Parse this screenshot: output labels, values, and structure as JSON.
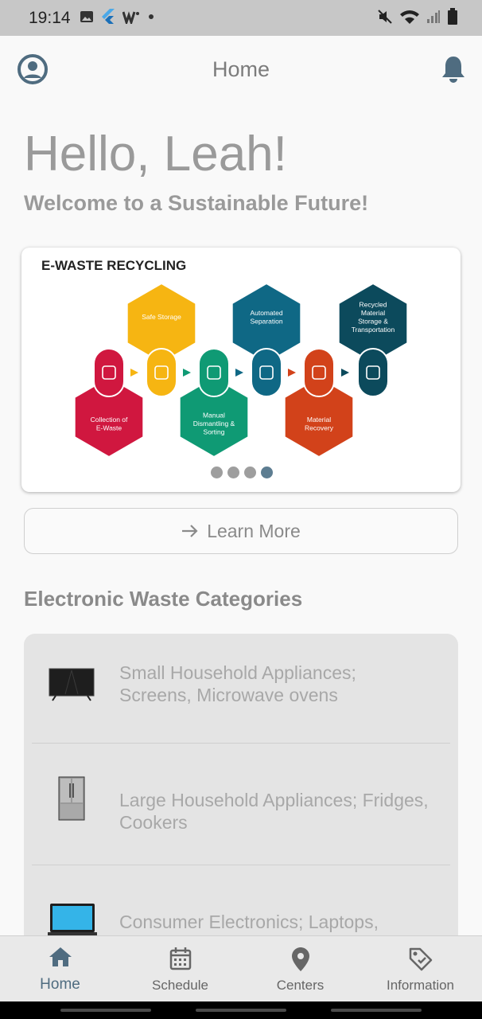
{
  "status_bar": {
    "time": "19:14"
  },
  "app_bar": {
    "title": "Home"
  },
  "greeting": "Hello, Leah!",
  "welcome": "Welcome to a Sustainable Future!",
  "carousel": {
    "title": "E-WASTE RECYCLING",
    "steps": [
      {
        "label": "Collection of E-Waste",
        "color": "#d0173f"
      },
      {
        "label": "Safe Storage",
        "color": "#f6b512"
      },
      {
        "label": "Manual Dismantling & Sorting",
        "color": "#0f9a74"
      },
      {
        "label": "Automated Separation",
        "color": "#0f6885"
      },
      {
        "label": "Material Recovery",
        "color": "#d2421a"
      },
      {
        "label": "Recycled Material Storage & Transportation",
        "color": "#0c4a5c"
      }
    ],
    "page_count": 4,
    "active_page": 4
  },
  "learn_more": {
    "label": "Learn More"
  },
  "categories": {
    "title": "Electronic Waste Categories",
    "items": [
      {
        "label": "Small Household Appliances; Screens, Microwave ovens",
        "icon": "tv-icon"
      },
      {
        "label": "Large Household Appliances; Fridges, Cookers",
        "icon": "fridge-icon"
      },
      {
        "label": "Consumer Electronics; Laptops,",
        "icon": "laptop-icon"
      }
    ]
  },
  "bottom_nav": {
    "items": [
      {
        "label": "Home",
        "icon": "home-icon",
        "active": true
      },
      {
        "label": "Schedule",
        "icon": "calendar-icon"
      },
      {
        "label": "Centers",
        "icon": "location-pin-icon"
      },
      {
        "label": "Information",
        "icon": "tag-icon"
      }
    ]
  },
  "colors": {
    "accent": "#4f6c80",
    "text_muted": "#9a9a9a",
    "status_bar": "#c7c7c7"
  }
}
